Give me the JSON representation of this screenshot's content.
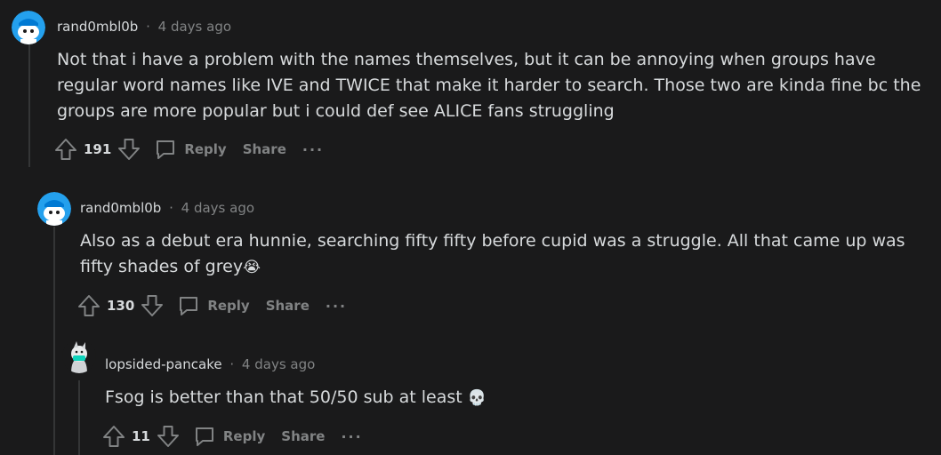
{
  "comments": [
    {
      "author": "rand0mbl0b",
      "separator": "·",
      "time": "4 days ago",
      "body": "Not that i have a problem with the names themselves, but it can be annoying when groups have regular word names like IVE and TWICE that make it harder to search. Those two are kinda fine bc the groups are more popular but i could def see ALICE fans struggling",
      "score": "191",
      "reply_label": "Reply",
      "share_label": "Share",
      "more_label": "···"
    },
    {
      "author": "rand0mbl0b",
      "separator": "·",
      "time": "4 days ago",
      "body": "Also as a debut era hunnie, searching fifty fifty before cupid was a struggle. All that came up was fifty shades of grey",
      "emoji": "😭",
      "score": "130",
      "reply_label": "Reply",
      "share_label": "Share",
      "more_label": "···"
    },
    {
      "author": "lopsided-pancake",
      "separator": "·",
      "time": "4 days ago",
      "body": "Fsog is better than that 50/50 sub at least ",
      "emoji": "💀",
      "score": "11",
      "reply_label": "Reply",
      "share_label": "Share",
      "more_label": "···"
    }
  ],
  "colors": {
    "background": "#1a1a1b",
    "text": "#d7dadc",
    "muted": "#818384",
    "thread_line": "#343536",
    "snoo_blue": "#0dd3bb"
  }
}
